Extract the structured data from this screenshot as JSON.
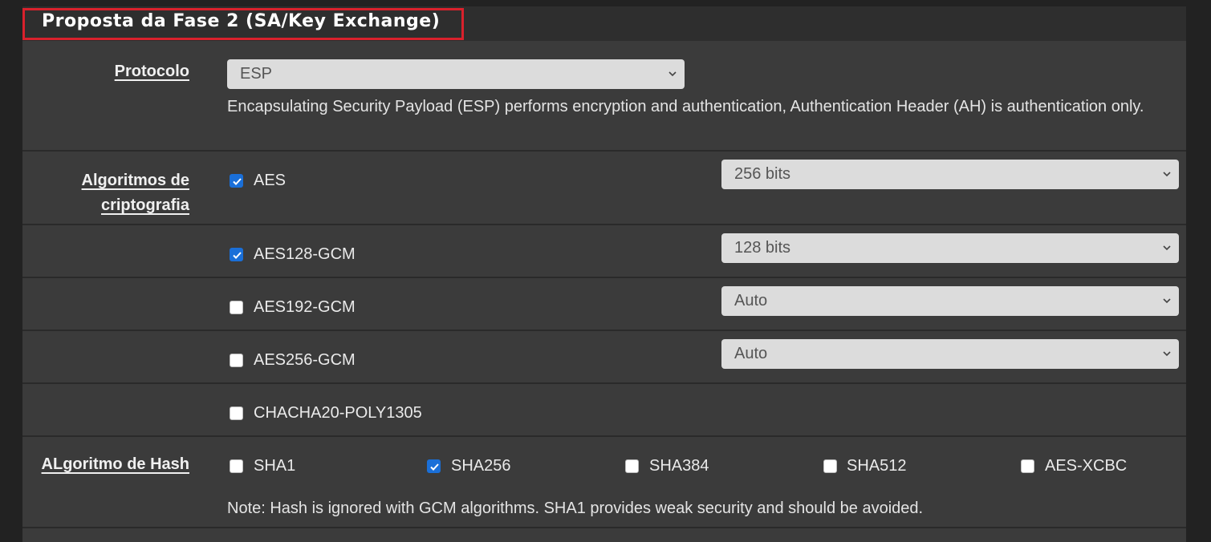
{
  "section": {
    "title": "Proposta da Fase 2 (SA/Key Exchange)"
  },
  "protocol": {
    "label": "Protocolo",
    "selected": "ESP",
    "help": "Encapsulating Security Payload (ESP) performs encryption and authentication, Authentication Header (AH) is authentication only."
  },
  "encryption": {
    "label_line1": "Algoritmos de",
    "label_line2": "criptografia",
    "algorithms": [
      {
        "name": "AES",
        "checked": true,
        "key_length": "256 bits"
      },
      {
        "name": "AES128-GCM",
        "checked": true,
        "key_length": "128 bits"
      },
      {
        "name": "AES192-GCM",
        "checked": false,
        "key_length": "Auto"
      },
      {
        "name": "AES256-GCM",
        "checked": false,
        "key_length": "Auto"
      },
      {
        "name": "CHACHA20-POLY1305",
        "checked": false
      }
    ]
  },
  "hash": {
    "label": "ALgoritmo de Hash",
    "options": [
      {
        "name": "SHA1",
        "checked": false
      },
      {
        "name": "SHA256",
        "checked": true
      },
      {
        "name": "SHA384",
        "checked": false
      },
      {
        "name": "SHA512",
        "checked": false
      },
      {
        "name": "AES-XCBC",
        "checked": false
      }
    ],
    "note": "Note: Hash is ignored with GCM algorithms. SHA1 provides weak security and should be avoided."
  },
  "colors": {
    "highlight_border": "#d9212c",
    "checkbox_checked": "#1a6fd8",
    "panel_bg": "#3b3b3b"
  }
}
